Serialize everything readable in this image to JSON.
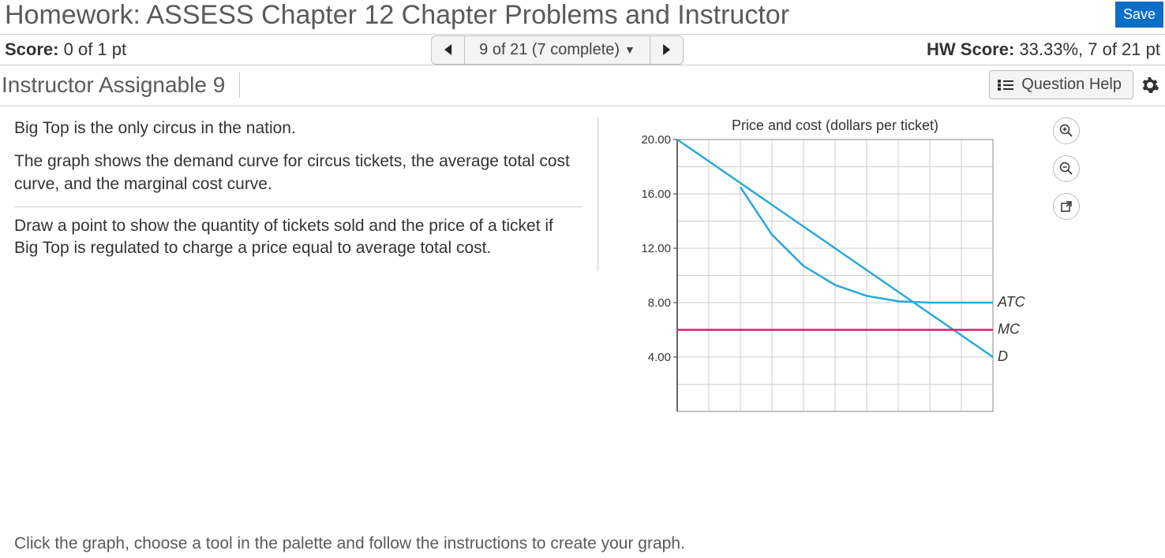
{
  "header": {
    "title": "Homework: ASSESS Chapter 12 Chapter Problems and Instructor",
    "save": "Save"
  },
  "scorebar": {
    "score_label": "Score:",
    "score_value": "0 of 1 pt",
    "nav": "9 of 21 (7 complete)",
    "hw_label": "HW Score:",
    "hw_value": "33.33%, 7 of 21 pt"
  },
  "question": {
    "title": "Instructor Assignable 9",
    "help": "Question Help"
  },
  "body": {
    "p1": "Big Top is the only circus in the nation.",
    "p2": "The graph shows the demand curve for circus tickets, the average total cost curve, and the marginal cost curve.",
    "p3": "Draw a point to show the quantity of tickets sold and the price of a ticket if Big Top is regulated to charge a price equal to average total cost."
  },
  "footer": "Click the graph, choose a tool in the palette and follow the instructions to create your graph.",
  "chart_data": {
    "type": "line",
    "title": "Price and cost (dollars per ticket)",
    "xlabel": "",
    "ylabel": "",
    "xlim": [
      0,
      500
    ],
    "ylim": [
      0,
      20
    ],
    "xticks": [
      0,
      50,
      100,
      150,
      200,
      250,
      300,
      350,
      400,
      450,
      500
    ],
    "yticks": [
      4,
      8,
      12,
      16,
      20
    ],
    "yticklabels": [
      "4.00",
      "8.00",
      "12.00",
      "16.00",
      "20.00"
    ],
    "series": [
      {
        "name": "D",
        "color": "#2aa8d8",
        "points": [
          [
            0,
            20
          ],
          [
            500,
            4
          ]
        ]
      },
      {
        "name": "ATC",
        "color": "#2aa8d8",
        "points": [
          [
            100,
            16.5
          ],
          [
            150,
            13
          ],
          [
            200,
            10.7
          ],
          [
            250,
            9.3
          ],
          [
            300,
            8.5
          ],
          [
            350,
            8.1
          ],
          [
            400,
            8
          ],
          [
            450,
            8
          ],
          [
            500,
            8
          ]
        ]
      },
      {
        "name": "MC",
        "color": "#e11b6b",
        "points": [
          [
            0,
            6
          ],
          [
            500,
            6
          ]
        ]
      }
    ],
    "labels": [
      {
        "text": "ATC",
        "x": 510,
        "y": 8,
        "style": "italic"
      },
      {
        "text": "MC",
        "x": 510,
        "y": 6,
        "style": "italic"
      },
      {
        "text": "D",
        "x": 510,
        "y": 4,
        "style": "italic"
      }
    ]
  }
}
